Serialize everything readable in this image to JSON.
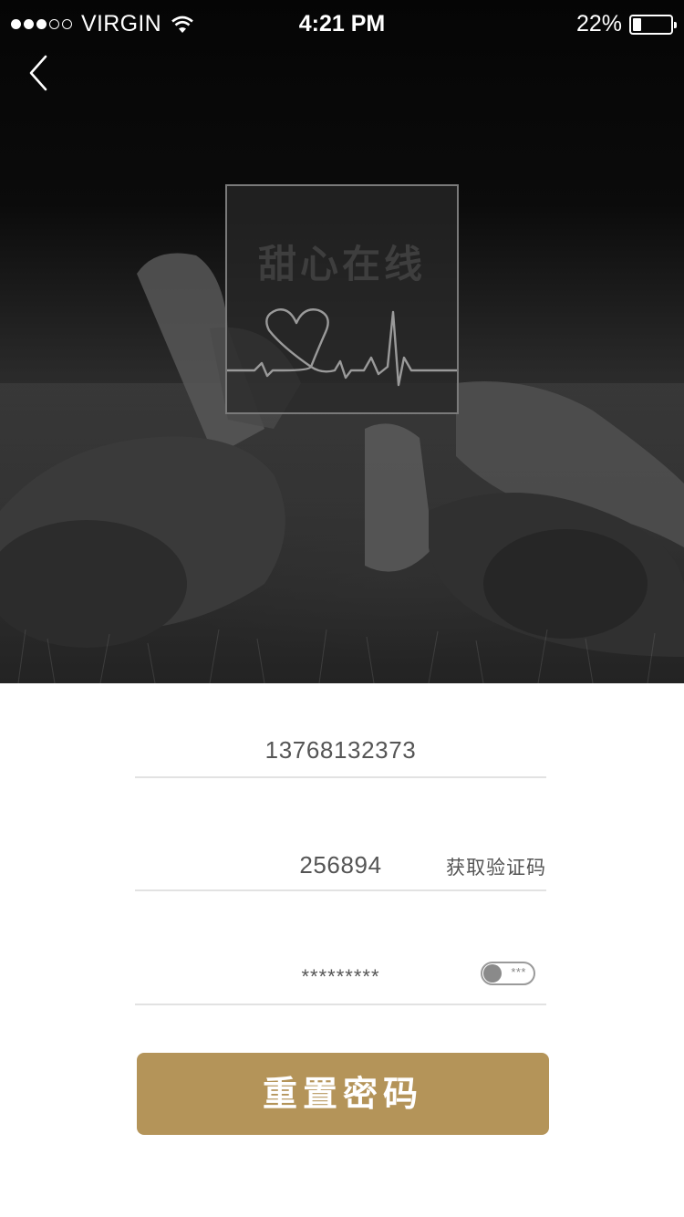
{
  "status_bar": {
    "carrier": "VIRGIN",
    "signal_bars": 3,
    "signal_max": 5,
    "time": "4:21 PM",
    "battery_percent": "22%",
    "battery_level": 0.22
  },
  "navigation": {
    "back_icon": "chevron-left-icon"
  },
  "logo": {
    "title": "甜心在线",
    "icon": "heartbeat-heart-icon"
  },
  "form": {
    "phone_value": "13768132373",
    "code_value": "256894",
    "get_code_label": "获取验证码",
    "password_value": "*********",
    "password_toggle_label": "***",
    "submit_label": "重置密码"
  },
  "colors": {
    "accent": "#b49459",
    "divider": "#e2e2e2",
    "text": "#555555"
  }
}
